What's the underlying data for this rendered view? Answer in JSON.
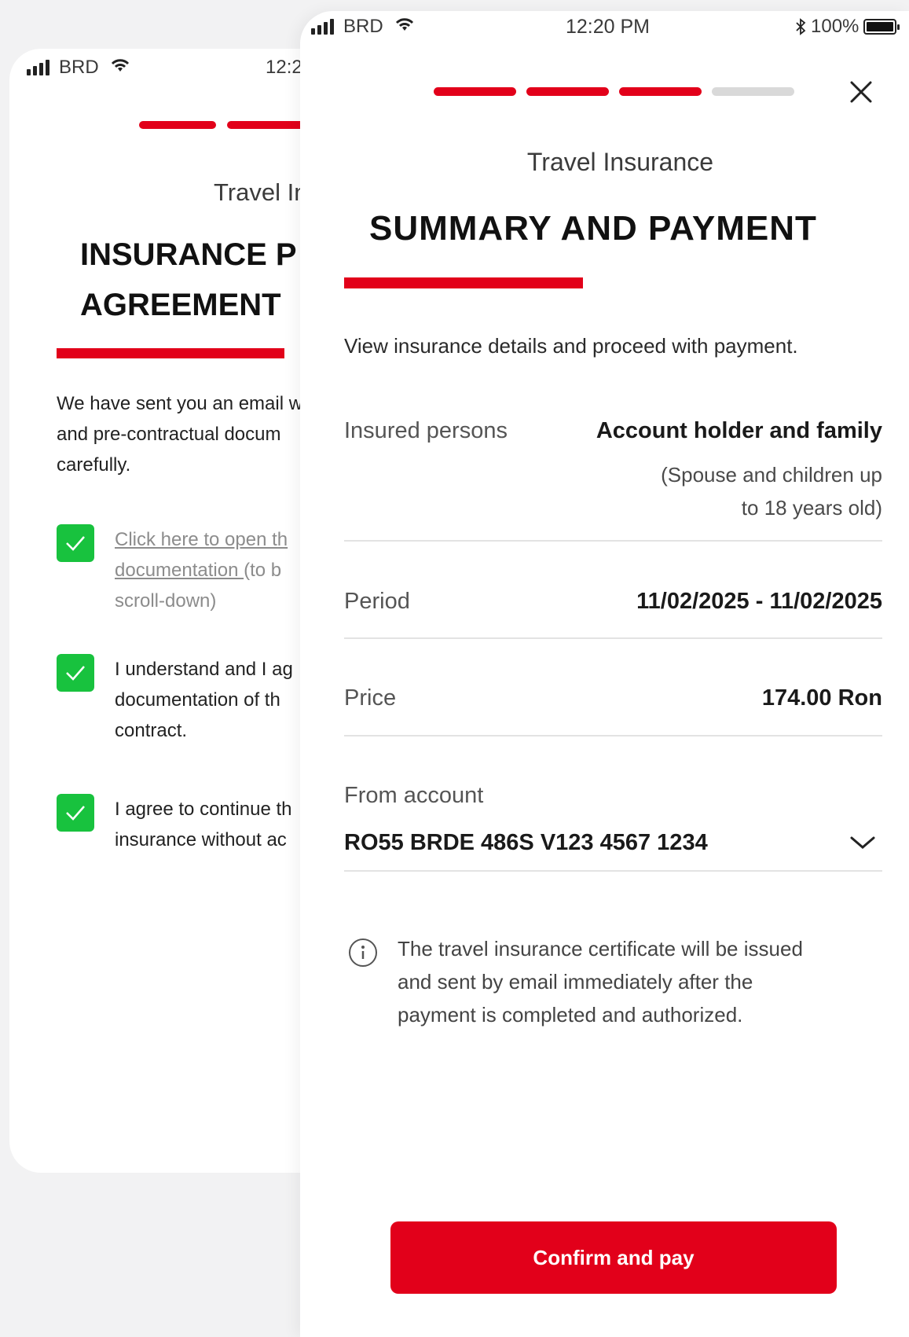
{
  "back_screen": {
    "status": {
      "carrier": "BRD",
      "time": "12:2"
    },
    "progress": {
      "completed_segments": 2,
      "color": "#e2001a"
    },
    "subtitle": "Travel In",
    "title": "INSURANCE P\nAGREEMENT",
    "intro": "We have sent you an email w\nand pre-contractual docum\ncarefully.",
    "checks": [
      {
        "line1": "Click here to open th",
        "line2_link": "documentation ",
        "line2_rest": "(to b",
        "line3": "scroll-down)",
        "checked": true
      },
      {
        "text": "I understand and I ag\ndocumentation of th\ncontract.",
        "checked": true
      },
      {
        "text": "I agree to continue th\ninsurance without ac",
        "checked": true
      }
    ]
  },
  "front_screen": {
    "status": {
      "carrier": "BRD",
      "time": "12:20 PM",
      "battery": "100%"
    },
    "progress": {
      "total_segments": 4,
      "completed_segments": 3,
      "active_color": "#e2001a",
      "inactive_color": "#d9d9d9"
    },
    "close_icon": "close-icon",
    "subtitle": "Travel Insurance",
    "title": "SUMMARY AND PAYMENT",
    "intro": "View insurance details and proceed with payment.",
    "details": {
      "insured_label": "Insured persons",
      "insured_value": "Account holder and family",
      "insured_note": "(Spouse and children up\nto 18 years old)",
      "period_label": "Period",
      "period_value": "11/02/2025 - 11/02/2025",
      "price_label": "Price",
      "price_value": "174.00 Ron"
    },
    "account": {
      "label": "From account",
      "value": "RO55 BRDE 486S V123 4567 1234",
      "icon": "chevron-down-icon"
    },
    "info": {
      "icon": "info-icon",
      "text": "The travel insurance certificate will be issued\nand sent by email immediately after the\npayment is completed and authorized."
    },
    "confirm_label": "Confirm and pay"
  }
}
